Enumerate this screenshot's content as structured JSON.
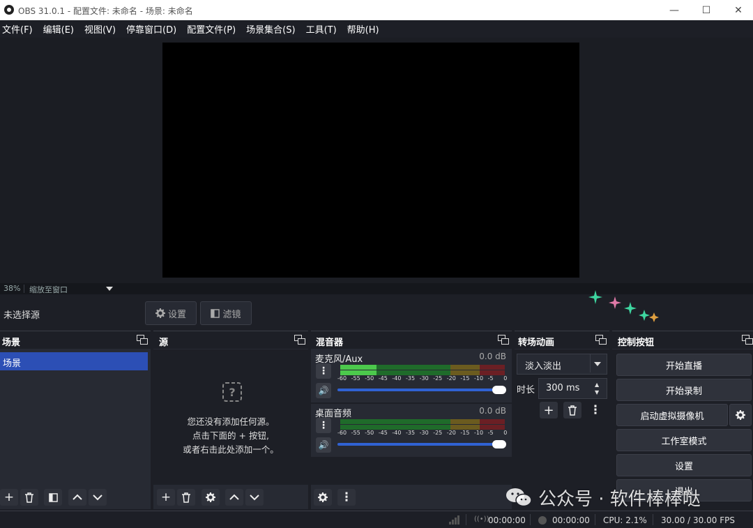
{
  "window": {
    "title": "OBS 31.0.1 - 配置文件: 未命名 - 场景: 未命名",
    "minimize": "—",
    "maximize": "☐",
    "close": "✕"
  },
  "menu": [
    "文件(F)",
    "编辑(E)",
    "视图(V)",
    "停靠窗口(D)",
    "配置文件(P)",
    "场景集合(S)",
    "工具(T)",
    "帮助(H)"
  ],
  "zoom": {
    "percent": "38%",
    "mode": "缩放至窗口"
  },
  "source_toolbar": {
    "no_source": "未选择源",
    "settings": "设置",
    "filters": "滤镜"
  },
  "docks": {
    "scenes": {
      "title": "场景",
      "items": [
        "场景"
      ]
    },
    "sources": {
      "title": "源",
      "empty_line1": "您还没有添加任何源。",
      "empty_line2": "点击下面的 + 按钮,",
      "empty_line3": "或者右击此处添加一个。"
    },
    "mixer": {
      "title": "混音器",
      "channels": [
        {
          "name": "麦克风/Aux",
          "db": "0.0 dB",
          "level": 0.22
        },
        {
          "name": "桌面音频",
          "db": "0.0 dB",
          "level": 0.0
        }
      ],
      "ticks": [
        "-60",
        "-55",
        "-50",
        "-45",
        "-40",
        "-35",
        "-30",
        "-25",
        "-20",
        "-15",
        "-10",
        "-5",
        "0"
      ]
    },
    "transitions": {
      "title": "转场动画",
      "selected": "淡入淡出",
      "duration_label": "时长",
      "duration": "300 ms"
    },
    "controls": {
      "title": "控制按钮",
      "start_stream": "开始直播",
      "start_record": "开始录制",
      "virtual_cam": "启动虚拟摄像机",
      "studio_mode": "工作室模式",
      "settings": "设置",
      "exit": "退出"
    }
  },
  "status": {
    "stream_time": "00:00:00",
    "record_time": "00:00:00",
    "cpu": "CPU: 2.1%",
    "fps": "30.00 / 30.00 FPS"
  },
  "watermark": "公众号 · 软件棒棒哒",
  "colors": {
    "accent": "#2c4fb5",
    "background": "#1d1f26",
    "panel": "#272a33",
    "slider": "#3062d3"
  }
}
